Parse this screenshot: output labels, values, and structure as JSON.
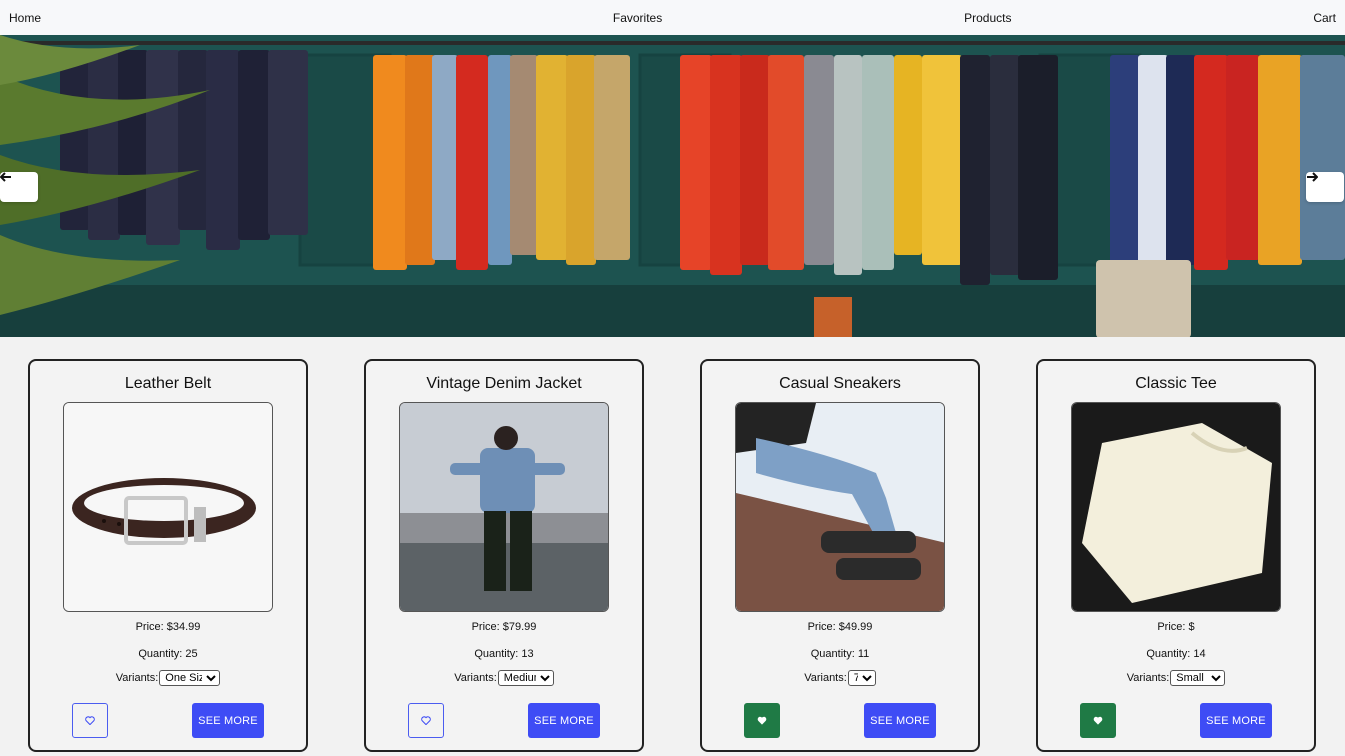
{
  "nav": {
    "home": "Home",
    "favorites": "Favorites",
    "products": "Products",
    "cart": "Cart"
  },
  "hero": {
    "prev_icon": "arrow-left-icon",
    "next_icon": "arrow-right-icon"
  },
  "products": [
    {
      "title": "Leather Belt",
      "price": "Price: $34.99",
      "quantity": "Quantity: 25",
      "variants_label": "Variants:",
      "variant_selected": "One Size",
      "favorited": false,
      "see_more": "SEE MORE",
      "image": "leather-belt-image"
    },
    {
      "title": "Vintage Denim Jacket",
      "price": "Price: $79.99",
      "quantity": "Quantity: 13",
      "variants_label": "Variants:",
      "variant_selected": "Medium",
      "favorited": false,
      "see_more": "SEE MORE",
      "image": "denim-jacket-image"
    },
    {
      "title": "Casual Sneakers",
      "price": "Price: $49.99",
      "quantity": "Quantity: 11",
      "variants_label": "Variants:",
      "variant_selected": "7",
      "favorited": true,
      "see_more": "SEE MORE",
      "image": "sneakers-image"
    },
    {
      "title": "Classic Tee",
      "price": "Price: $",
      "quantity": "Quantity: 14",
      "variants_label": "Variants:",
      "variant_selected": "Small",
      "favorited": true,
      "see_more": "SEE MORE",
      "image": "classic-tee-image"
    }
  ],
  "colors": {
    "primary": "#3e4cf5",
    "favorite_on": "#1f7a45",
    "favorite_off_border": "#4b5cf0"
  }
}
